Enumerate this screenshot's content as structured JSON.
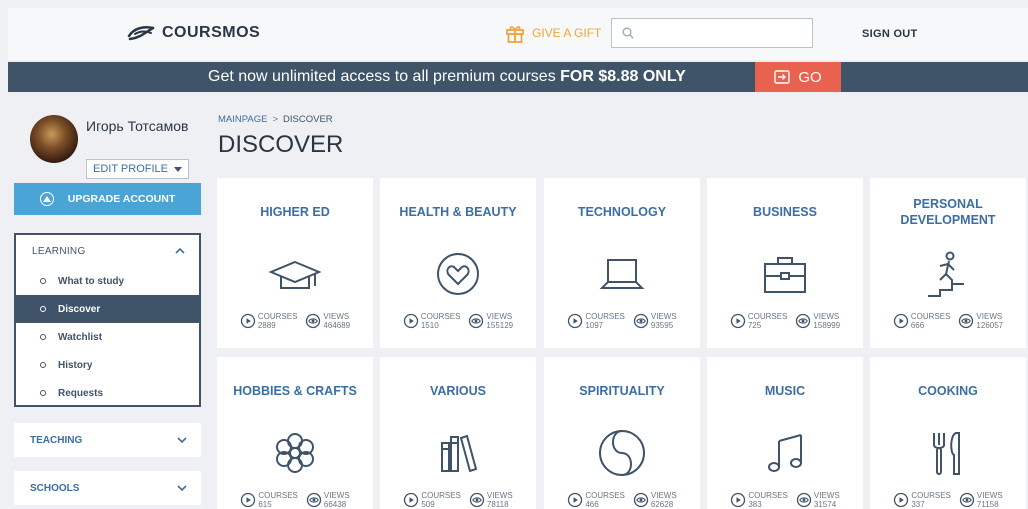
{
  "header": {
    "logo_text": "COURSMOS",
    "gift_label": "GIVE A GIFT",
    "search_placeholder": "",
    "signout_label": "SIGN OUT"
  },
  "promo": {
    "text": "Get now unlimited access to all premium courses",
    "highlight": "FOR $8.88 ONLY",
    "go_label": "GO"
  },
  "sidebar": {
    "user_name": "Игорь Тотсамов",
    "edit_profile_label": "EDIT PROFILE",
    "upgrade_label": "UPGRADE ACCOUNT",
    "learning": {
      "label": "LEARNING",
      "items": [
        {
          "label": "What to study",
          "active": false
        },
        {
          "label": "Discover",
          "active": true
        },
        {
          "label": "Watchlist",
          "active": false
        },
        {
          "label": "History",
          "active": false
        },
        {
          "label": "Requests",
          "active": false
        }
      ]
    },
    "teaching_label": "TEACHING",
    "schools_label": "SCHOOLS"
  },
  "main": {
    "breadcrumb": {
      "home": "MAINPAGE",
      "separator": ">",
      "current": "DISCOVER"
    },
    "title": "DISCOVER",
    "stats_labels": {
      "courses": "COURSES",
      "views": "VIEWS"
    },
    "categories": [
      {
        "title": "HIGHER ED",
        "icon": "graduation-cap-icon",
        "courses": "2889",
        "views": "464689"
      },
      {
        "title": "HEALTH & BEAUTY",
        "icon": "heart-icon",
        "courses": "1510",
        "views": "155129"
      },
      {
        "title": "TECHNOLOGY",
        "icon": "laptop-icon",
        "courses": "1097",
        "views": "93595"
      },
      {
        "title": "BUSINESS",
        "icon": "briefcase-icon",
        "courses": "725",
        "views": "158999"
      },
      {
        "title": "PERSONAL DEVELOPMENT",
        "icon": "stairs-climber-icon",
        "courses": "666",
        "views": "126057"
      },
      {
        "title": "HOBBIES & CRAFTS",
        "icon": "flower-icon",
        "courses": "615",
        "views": "66438"
      },
      {
        "title": "VARIOUS",
        "icon": "books-icon",
        "courses": "509",
        "views": "78118"
      },
      {
        "title": "SPIRITUALITY",
        "icon": "yin-yang-icon",
        "courses": "466",
        "views": "62628"
      },
      {
        "title": "MUSIC",
        "icon": "music-note-icon",
        "courses": "383",
        "views": "31574"
      },
      {
        "title": "COOKING",
        "icon": "cutlery-icon",
        "courses": "337",
        "views": "71158"
      }
    ]
  },
  "colors": {
    "primary": "#3f5369",
    "link": "#3b6ea5",
    "accent": "#4aa4d6",
    "go": "#e8624f",
    "gift": "#f0a53a"
  }
}
